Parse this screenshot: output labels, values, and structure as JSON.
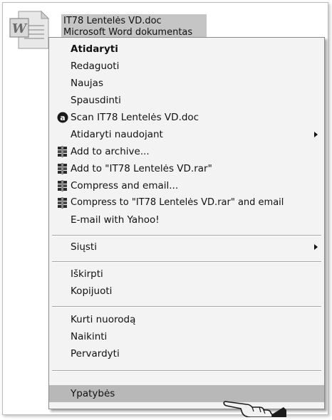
{
  "file": {
    "name": "IT78 Lentelės VD.doc",
    "type": "Microsoft Word dokumentas",
    "icon": "word-document-icon"
  },
  "menu": {
    "items": [
      {
        "label": "Atidaryti",
        "bold": true
      },
      {
        "label": "Redaguoti"
      },
      {
        "label": "Naujas"
      },
      {
        "label": "Spausdinti"
      },
      {
        "label": "Scan IT78 Lentelės VD.doc",
        "icon": "antivirus-scan-icon"
      },
      {
        "label": "Atidaryti naudojant",
        "submenu": true
      },
      {
        "label": "Add to archive...",
        "icon": "winrar-archive-icon"
      },
      {
        "label": "Add to \"IT78 Lentelės VD.rar\"",
        "icon": "winrar-archive-icon"
      },
      {
        "label": "Compress and email...",
        "icon": "winrar-archive-icon"
      },
      {
        "label": "Compress to \"IT78 Lentelės VD.rar\" and email",
        "icon": "winrar-archive-icon"
      },
      {
        "label": "E-mail with Yahoo!"
      },
      {
        "label": "Siųsti",
        "submenu": true
      },
      {
        "label": "Iškirpti"
      },
      {
        "label": "Kopijuoti"
      },
      {
        "label": "Kurti nuorodą"
      },
      {
        "label": "Naikinti"
      },
      {
        "label": "Pervardyti"
      },
      {
        "label": "Ypatybės",
        "selected": true
      }
    ]
  },
  "colors": {
    "menu_background": "#f3f3f3",
    "selection_highlight": "#b8b8b8",
    "file_selection": "#c5c5c5"
  }
}
